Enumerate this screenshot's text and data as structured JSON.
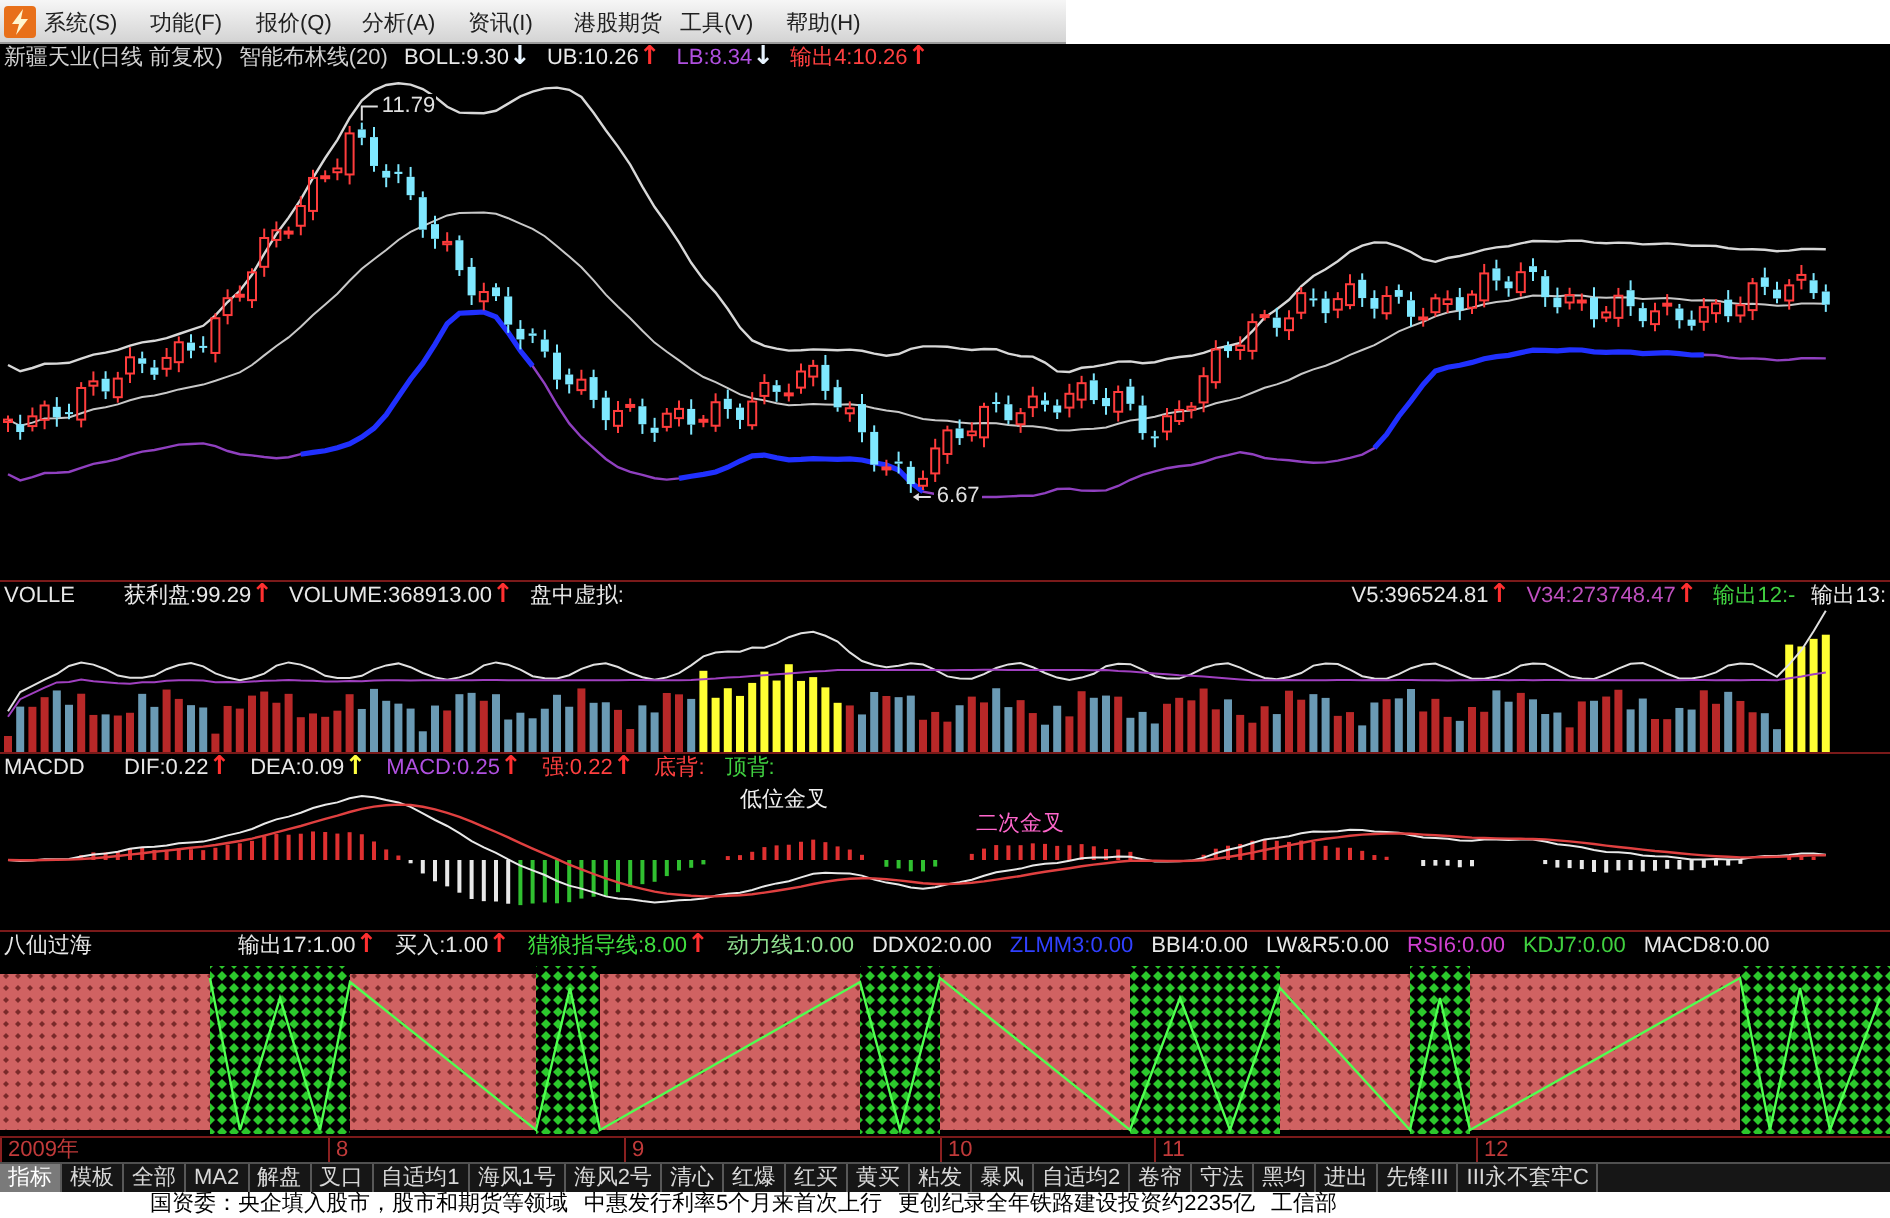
{
  "menu": {
    "items": [
      "系统(S)",
      "功能(F)",
      "报价(Q)",
      "分析(A)",
      "资讯(I)",
      "港股期货",
      "工具(V)",
      "帮助(H)"
    ]
  },
  "price_panel": {
    "readings": [
      {
        "text": "新疆天业(日线 前复权)",
        "color": "#d0d0d0"
      },
      {
        "text": "智能布林线(20)",
        "color": "#d0d0d0"
      },
      {
        "text": "BOLL:9.30",
        "arrow": {
          "text": "↓",
          "color": "#e8f4ff"
        },
        "color": "#e8e8e8"
      },
      {
        "text": "UB:10.26",
        "arrow": {
          "text": "↑",
          "color": "#ff3030"
        },
        "color": "#e8e8e8"
      },
      {
        "text": "LB:8.34",
        "arrow": {
          "text": "↓",
          "color": "#e8f4ff"
        },
        "color": "#b050e0"
      },
      {
        "text": "输出4:10.26",
        "arrow": {
          "text": "↑",
          "color": "#ff3030"
        },
        "color": "#ff4040"
      }
    ],
    "high_label": "11.79",
    "low_label": "6.67"
  },
  "volume_panel": {
    "readings": [
      {
        "text": "VOLLE",
        "color": "#e8e8e8"
      },
      {
        "text": "获利盘:99.29",
        "arrow": {
          "text": "↑",
          "color": "#ff3030"
        },
        "color": "#e8e8e8"
      },
      {
        "text": "VOLUME:368913.00",
        "arrow": {
          "text": "↑",
          "color": "#ff3030"
        },
        "color": "#e8e8e8"
      },
      {
        "text": "盘中虚拟:",
        "color": "#e8e8e8"
      }
    ],
    "right_readings": [
      {
        "text": "V5:396524.81",
        "arrow": {
          "text": "↑",
          "color": "#ff3030"
        },
        "color": "#e8e8e8"
      },
      {
        "text": "V34:273748.47",
        "arrow": {
          "text": "↑",
          "color": "#ff3030"
        },
        "color": "#c050c0"
      },
      {
        "text": "输出12:-",
        "color": "#40d040"
      },
      {
        "text": "输出13:",
        "color": "#e8e8e8"
      }
    ]
  },
  "macd_panel": {
    "readings": [
      {
        "text": "MACDD",
        "color": "#e8e8e8"
      },
      {
        "text": "DIF:0.22",
        "arrow": {
          "text": "↑",
          "color": "#ff3030"
        },
        "color": "#e8e8e8"
      },
      {
        "text": "DEA:0.09",
        "arrow": {
          "text": "↑",
          "color": "#ffff40"
        },
        "color": "#e8e8e8"
      },
      {
        "text": "MACD:0.25",
        "arrow": {
          "text": "↑",
          "color": "#ff3030"
        },
        "color": "#b050e0"
      },
      {
        "text": "强:0.22",
        "arrow": {
          "text": "↑",
          "color": "#ff3030"
        },
        "color": "#ff4040"
      },
      {
        "text": "底背:",
        "color": "#ff4040"
      },
      {
        "text": "顶背:",
        "color": "#40d040"
      }
    ],
    "signals": [
      {
        "text": "低位金叉",
        "color": "#f0f0f0"
      },
      {
        "text": "二次金叉",
        "color": "#ff66cc"
      }
    ]
  },
  "signal_panel": {
    "readings": [
      {
        "text": "八仙过海",
        "color": "#e8e8e8"
      },
      {
        "text": "输出17:1.00",
        "arrow": {
          "text": "↑",
          "color": "#ff3030"
        },
        "color": "#e8e8e8"
      },
      {
        "text": "买入:1.00",
        "arrow": {
          "text": "↑",
          "color": "#ff3030"
        },
        "color": "#e8e8e8"
      },
      {
        "text": "猎狼指导线:8.00",
        "arrow": {
          "text": "↑",
          "color": "#ff3030"
        },
        "color": "#40e040"
      },
      {
        "text": "动力线1:0.00",
        "color": "#90e090"
      },
      {
        "text": "DDX02:0.00",
        "color": "#e8e8e8"
      },
      {
        "text": "ZLMM3:0.00",
        "color": "#3040ff"
      },
      {
        "text": "BBI4:0.00",
        "color": "#e8e8e8"
      },
      {
        "text": "LW&R5:0.00",
        "color": "#e8e8e8"
      },
      {
        "text": "RSI6:0.00",
        "color": "#d040d0"
      },
      {
        "text": "KDJ7:0.00",
        "color": "#40d040"
      },
      {
        "text": "MACD8:0.00",
        "color": "#e8e8e8"
      }
    ]
  },
  "date_axis": {
    "labels": [
      "2009年",
      "8",
      "9",
      "10",
      "11",
      "12"
    ]
  },
  "tabs": [
    {
      "label": "指标",
      "selected": true
    },
    {
      "label": "模板",
      "selected": false
    },
    {
      "label": "全部",
      "selected": false
    },
    {
      "label": "MA2",
      "selected": false
    },
    {
      "label": "解盘",
      "selected": false
    },
    {
      "label": "叉口",
      "selected": false
    },
    {
      "label": "自适均1",
      "selected": false
    },
    {
      "label": "海风1号",
      "selected": false
    },
    {
      "label": "海风2号",
      "selected": false
    },
    {
      "label": "清心",
      "selected": false
    },
    {
      "label": "红爆",
      "selected": false
    },
    {
      "label": "红买",
      "selected": false
    },
    {
      "label": "黄买",
      "selected": false
    },
    {
      "label": "粘发",
      "selected": false
    },
    {
      "label": "暴风",
      "selected": false
    },
    {
      "label": "自适均2",
      "selected": false
    },
    {
      "label": "卷帘",
      "selected": false
    },
    {
      "label": "守法",
      "selected": false
    },
    {
      "label": "黑均",
      "selected": false
    },
    {
      "label": "进出",
      "selected": false
    },
    {
      "label": "先锋III",
      "selected": false
    },
    {
      "label": "III永不套牢C",
      "selected": false
    }
  ],
  "news": [
    "国资委：央企填入股市，股市和期货等领域",
    "中惠发行利率5个月来首次上行",
    "更创纪录全年铁路建设投资约2235亿",
    "工信部"
  ]
}
